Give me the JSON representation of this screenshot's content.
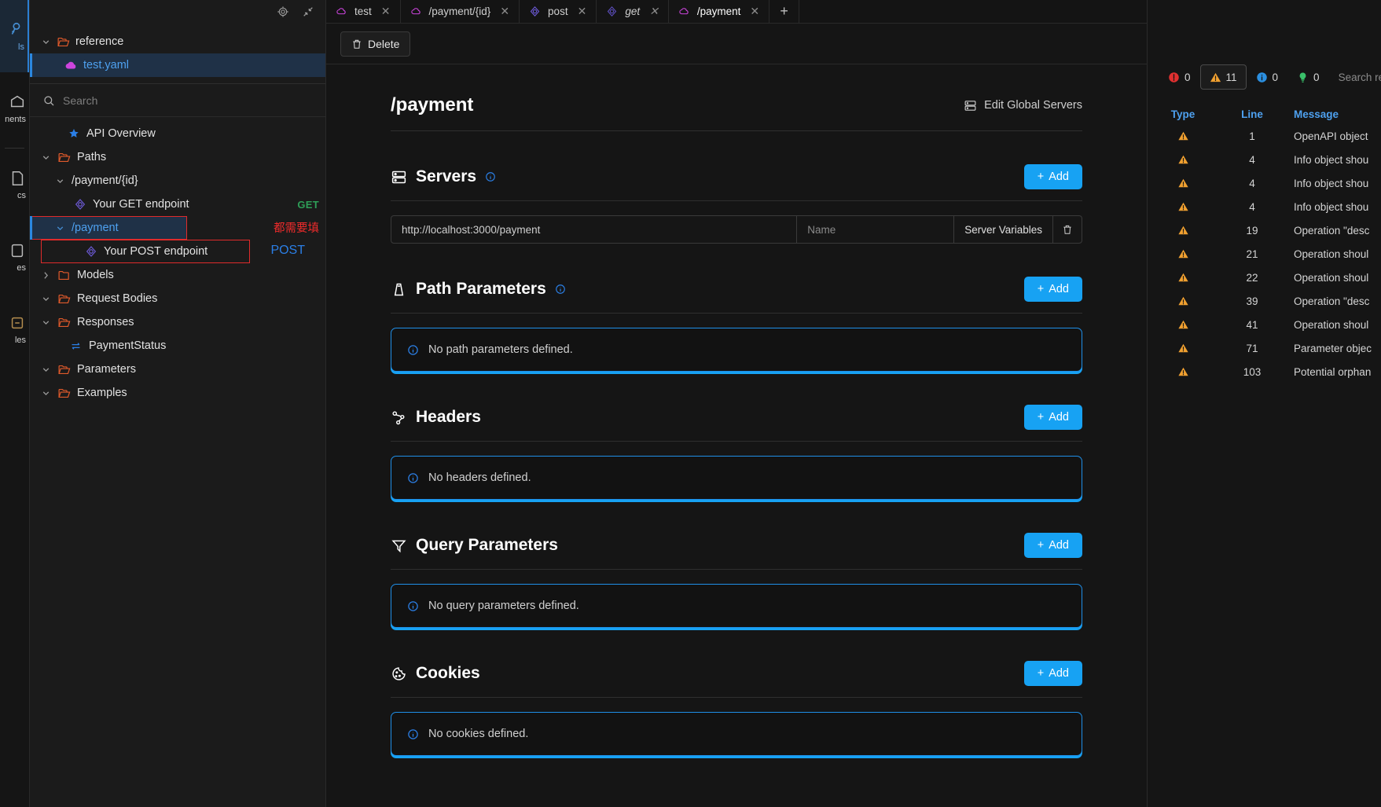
{
  "rail": {
    "items": [
      {
        "label": "ls",
        "icon": "key-icon",
        "active": true
      },
      {
        "label": "nents",
        "icon": "components-icon",
        "active": false
      },
      {
        "label": "cs",
        "icon": "docs-icon",
        "active": false
      },
      {
        "label": "es",
        "icon": "rules-icon",
        "active": false
      },
      {
        "label": "les",
        "icon": "files-icon",
        "active": false
      }
    ]
  },
  "explorer": {
    "header_icons": [
      "settings-icon",
      "collapse-icon"
    ],
    "tree": [
      {
        "label": "reference",
        "type": "folder",
        "expanded": true,
        "selected": false
      },
      {
        "label": "test.yaml",
        "type": "file",
        "expanded": false,
        "selected": true
      }
    ],
    "search": {
      "placeholder": "Search",
      "value": ""
    },
    "nav": [
      {
        "label": "API Overview",
        "icon": "star-icon",
        "indent": 1,
        "kind": "overview",
        "method": ""
      },
      {
        "label": "Paths",
        "icon": "folder-open-icon",
        "indent": 0,
        "kind": "folder",
        "expanded": true,
        "method": ""
      },
      {
        "label": "/payment/{id}",
        "icon": "none",
        "indent": 1,
        "kind": "path",
        "expanded": true,
        "method": ""
      },
      {
        "label": "Your GET endpoint",
        "icon": "target-icon",
        "indent": 2,
        "kind": "operation",
        "method": "GET"
      },
      {
        "label": "/payment",
        "icon": "none",
        "indent": 1,
        "kind": "path",
        "expanded": true,
        "method": "",
        "selected": true,
        "annotated": true,
        "annotation": "都需要填"
      },
      {
        "label": "Your POST endpoint",
        "icon": "target-icon",
        "indent": 2,
        "kind": "operation",
        "method": "POST",
        "annotated": true
      },
      {
        "label": "Models",
        "icon": "folder-closed-icon",
        "indent": 0,
        "kind": "folder",
        "expanded": false,
        "method": ""
      },
      {
        "label": "Request Bodies",
        "icon": "folder-open-icon",
        "indent": 0,
        "kind": "folder",
        "expanded": true,
        "method": ""
      },
      {
        "label": "Responses",
        "icon": "folder-open-icon",
        "indent": 0,
        "kind": "folder",
        "expanded": true,
        "method": ""
      },
      {
        "label": "PaymentStatus",
        "icon": "swap-icon",
        "indent": 1,
        "kind": "response",
        "method": ""
      },
      {
        "label": "Parameters",
        "icon": "folder-open-icon",
        "indent": 0,
        "kind": "folder",
        "expanded": true,
        "method": ""
      },
      {
        "label": "Examples",
        "icon": "folder-open-icon",
        "indent": 0,
        "kind": "folder",
        "expanded": true,
        "method": ""
      }
    ]
  },
  "tabs": [
    {
      "label": "test",
      "icon": "cloud-icon",
      "active": false,
      "italic": false
    },
    {
      "label": "/payment/{id}",
      "icon": "cloud-icon",
      "active": false,
      "italic": false
    },
    {
      "label": "post",
      "icon": "target-icon",
      "active": false,
      "italic": false
    },
    {
      "label": "get",
      "icon": "target-icon",
      "active": false,
      "italic": true
    },
    {
      "label": "/payment",
      "icon": "cloud-icon",
      "active": true,
      "italic": false
    }
  ],
  "tab_add_label": "+",
  "toolbar": {
    "delete_label": "Delete",
    "delete_icon": "trash-icon"
  },
  "main": {
    "title": "/payment",
    "edit_global_servers": "Edit Global Servers",
    "sections": [
      {
        "id": "servers",
        "title": "Servers",
        "icon": "server-icon",
        "has_info": true,
        "add_label": "Add",
        "kind": "table",
        "row": {
          "url": "http://localhost:3000/payment",
          "name_placeholder": "Name",
          "variables_label": "Server Variables",
          "delete_icon": "trash-icon"
        }
      },
      {
        "id": "path-parameters",
        "title": "Path Parameters",
        "icon": "path-param-icon",
        "has_info": true,
        "add_label": "Add",
        "kind": "empty",
        "empty_text": "No path parameters defined."
      },
      {
        "id": "headers",
        "title": "Headers",
        "icon": "headers-icon",
        "has_info": false,
        "add_label": "Add",
        "kind": "empty",
        "empty_text": "No headers defined."
      },
      {
        "id": "query-parameters",
        "title": "Query Parameters",
        "icon": "filter-icon",
        "has_info": false,
        "add_label": "Add",
        "kind": "empty",
        "empty_text": "No query parameters defined."
      },
      {
        "id": "cookies",
        "title": "Cookies",
        "icon": "cookie-icon",
        "has_info": false,
        "add_label": "Add",
        "kind": "empty",
        "empty_text": "No cookies defined."
      }
    ]
  },
  "diagnostics": {
    "filters": [
      {
        "id": "errors",
        "icon": "error-icon",
        "count": "0",
        "active": false
      },
      {
        "id": "warnings",
        "icon": "warning-icon",
        "count": "11",
        "active": true
      },
      {
        "id": "info",
        "icon": "info-icon",
        "count": "0",
        "active": false
      },
      {
        "id": "hints",
        "icon": "hint-icon",
        "count": "0",
        "active": false
      }
    ],
    "search": {
      "placeholder": "Search results...",
      "value": ""
    },
    "columns": [
      "Type",
      "Line",
      "Message"
    ],
    "rows": [
      {
        "type": "warning",
        "line": "1",
        "message": "OpenAPI object"
      },
      {
        "type": "warning",
        "line": "4",
        "message": "Info object shou"
      },
      {
        "type": "warning",
        "line": "4",
        "message": "Info object shou"
      },
      {
        "type": "warning",
        "line": "4",
        "message": "Info object shou"
      },
      {
        "type": "warning",
        "line": "19",
        "message": "Operation \"desc"
      },
      {
        "type": "warning",
        "line": "21",
        "message": "Operation shoul"
      },
      {
        "type": "warning",
        "line": "22",
        "message": "Operation shoul"
      },
      {
        "type": "warning",
        "line": "39",
        "message": "Operation \"desc"
      },
      {
        "type": "warning",
        "line": "41",
        "message": "Operation shoul"
      },
      {
        "type": "warning",
        "line": "71",
        "message": "Parameter objec"
      },
      {
        "type": "warning",
        "line": "103",
        "message": "Potential orphan"
      }
    ]
  },
  "colors": {
    "accent_blue": "#17a2f3",
    "selection_blue": "#1f3147",
    "warning_orange": "#f0a030",
    "error_red": "#e03030",
    "annotation_red": "#ef2b2b",
    "method_get": "#2e9e57",
    "method_post": "#2b7fe6",
    "folder_orange": "#e05a2b",
    "cloud_magenta": "#cc44dd"
  }
}
